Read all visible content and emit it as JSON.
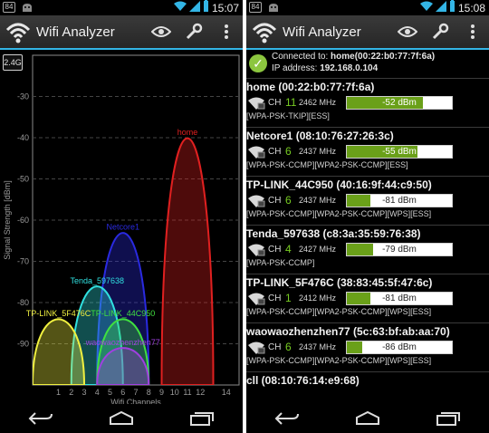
{
  "left": {
    "statusbar": {
      "notification": "84",
      "time": "15:07"
    },
    "app_title": "Wifi Analyzer",
    "band_button": "2.4G"
  },
  "right": {
    "statusbar": {
      "notification": "84",
      "time": "15:08"
    },
    "app_title": "Wifi Analyzer",
    "connection": {
      "connected_prefix": "Connected to:",
      "connected_value": "home(00:22:b0:77:7f:6a)",
      "ip_prefix": "IP address:",
      "ip_value": "192.168.0.104"
    },
    "access_points": [
      {
        "name": "home (00:22:b0:77:7f:6a)",
        "ch_label": "CH",
        "channel": "11",
        "channel_color": "#77cc22",
        "freq": "2462 MHz",
        "dbm": "-52 dBm",
        "level": 0.72,
        "caps": "[WPA-PSK-TKIP][ESS]"
      },
      {
        "name": "Netcore1 (08:10:76:27:26:3c)",
        "ch_label": "CH",
        "channel": "6",
        "channel_color": "#77cc22",
        "freq": "2437 MHz",
        "dbm": "-55 dBm",
        "level": 0.67,
        "caps": "[WPA-PSK-CCMP][WPA2-PSK-CCMP][ESS]"
      },
      {
        "name": "TP-LINK_44C950 (40:16:9f:44:c9:50)",
        "ch_label": "CH",
        "channel": "6",
        "channel_color": "#77cc22",
        "freq": "2437 MHz",
        "dbm": "-81 dBm",
        "level": 0.22,
        "caps": "[WPA-PSK-CCMP][WPA2-PSK-CCMP][WPS][ESS]"
      },
      {
        "name": "Tenda_597638 (c8:3a:35:59:76:38)",
        "ch_label": "CH",
        "channel": "4",
        "channel_color": "#77cc22",
        "freq": "2427 MHz",
        "dbm": "-79 dBm",
        "level": 0.25,
        "caps": "[WPA-PSK-CCMP]"
      },
      {
        "name": "TP-LINK_5F476C (38:83:45:5f:47:6c)",
        "ch_label": "CH",
        "channel": "1",
        "channel_color": "#77cc22",
        "freq": "2412 MHz",
        "dbm": "-81 dBm",
        "level": 0.22,
        "caps": "[WPA-PSK-CCMP][WPA2-PSK-CCMP][WPS][ESS]"
      },
      {
        "name": "waowaozhenzhen77 (5c:63:bf:ab:aa:70)",
        "ch_label": "CH",
        "channel": "6",
        "channel_color": "#77cc22",
        "freq": "2437 MHz",
        "dbm": "-86 dBm",
        "level": 0.15,
        "caps": "[WPA-PSK-CCMP][WPA2-PSK-CCMP][WPS][ESS]"
      },
      {
        "name": "cll (08:10:76:14:e9:68)",
        "ch_label": "",
        "channel": "",
        "channel_color": "#77cc22",
        "freq": "",
        "dbm": "",
        "level": 0,
        "caps": ""
      }
    ]
  },
  "chart_data": {
    "type": "area",
    "title": "",
    "xlabel": "Wifi Channels",
    "ylabel": "Signal Strength [dBm]",
    "xlim": [
      -1,
      15
    ],
    "ylim": [
      -100,
      -20
    ],
    "x_ticks": [
      1,
      2,
      3,
      4,
      5,
      6,
      7,
      8,
      9,
      10,
      11,
      12,
      14
    ],
    "y_ticks": [
      -30,
      -40,
      -50,
      -60,
      -70,
      -80,
      -90
    ],
    "series": [
      {
        "name": "home",
        "channel": 11,
        "dbm": -40,
        "color": "#e02020"
      },
      {
        "name": "Netcore1",
        "channel": 6,
        "dbm": -63,
        "color": "#2a2ae0"
      },
      {
        "name": "Tenda_597638",
        "channel": 4,
        "dbm": -76,
        "color": "#30e0e0"
      },
      {
        "name": "TP-LINK_44C950",
        "channel": 6,
        "dbm": -84,
        "color": "#40e040"
      },
      {
        "name": "TP-LINK_5F476C",
        "channel": 1,
        "dbm": -84,
        "color": "#f0f040"
      },
      {
        "name": "waowaozhenzhen77",
        "channel": 6,
        "dbm": -91,
        "color": "#a040e0"
      }
    ],
    "grid": true
  },
  "navbar": {
    "back": "back-icon",
    "home": "home-icon",
    "recents": "recents-icon"
  }
}
